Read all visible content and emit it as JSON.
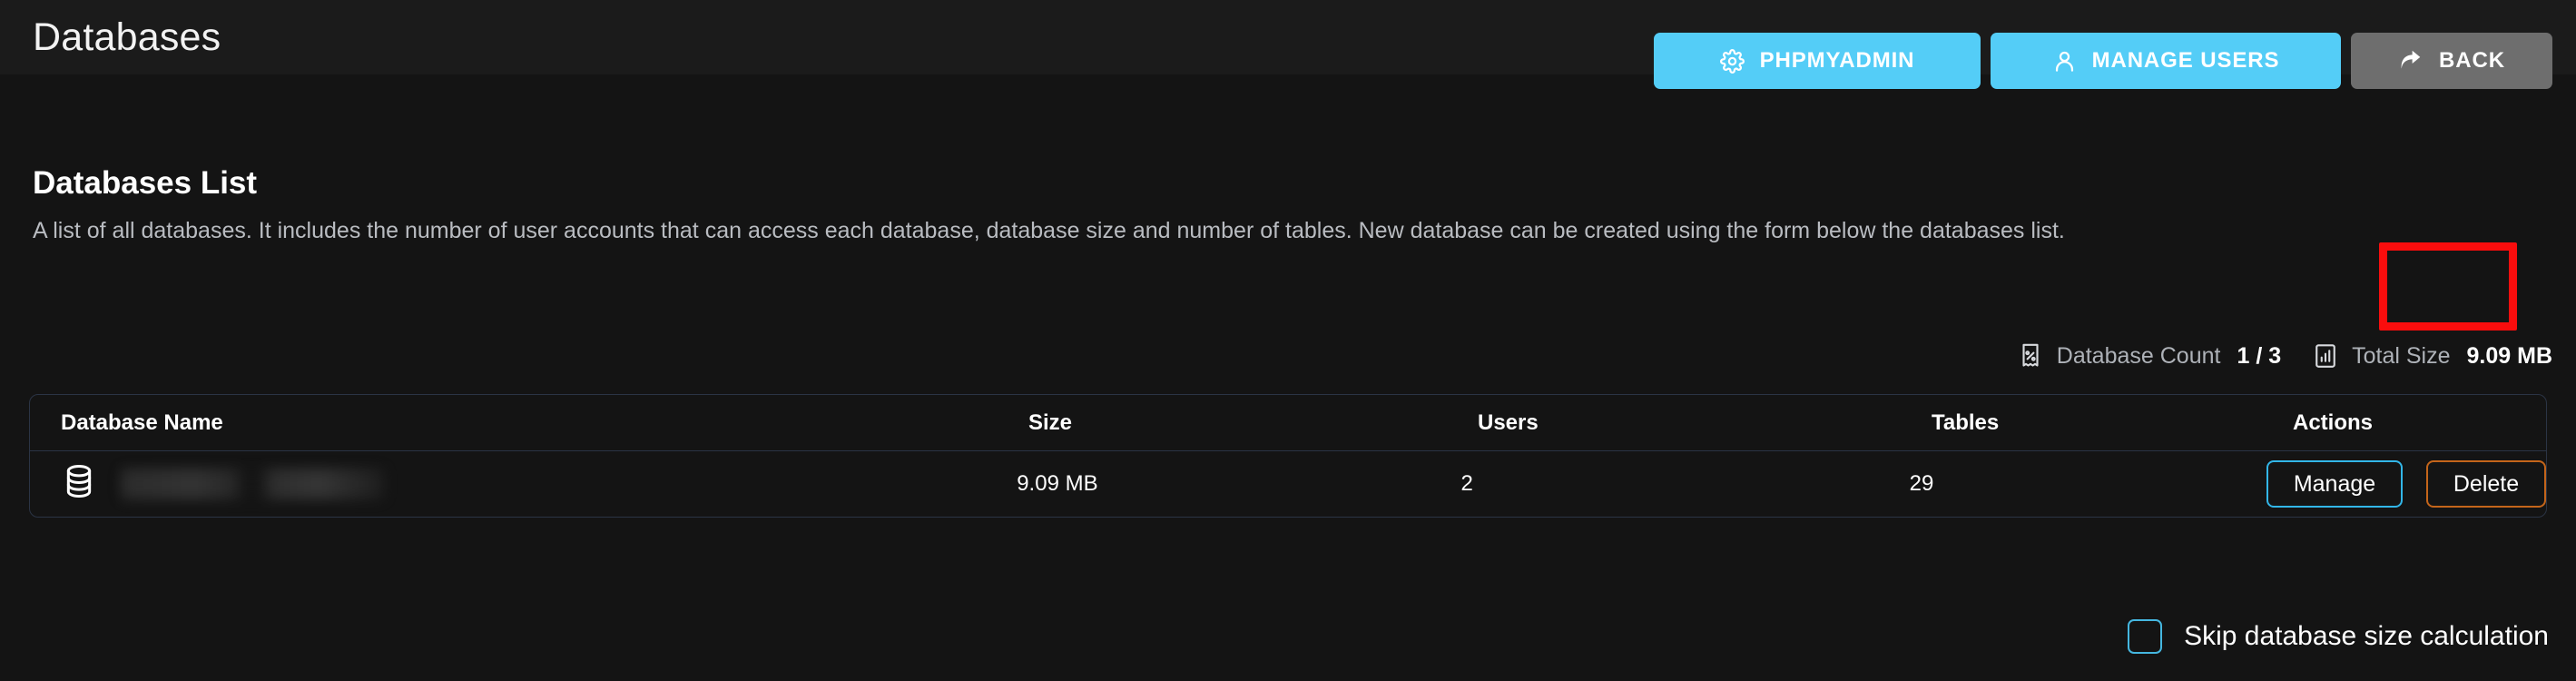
{
  "header": {
    "title": "Databases",
    "buttons": [
      {
        "label": "PHPMYADMIN",
        "icon": "gear-icon",
        "color": "#54cdf7"
      },
      {
        "label": "MANAGE USERS",
        "icon": "user-icon",
        "color": "#54cdf7"
      },
      {
        "label": "BACK",
        "icon": "forward-arrow-icon",
        "color": "#6e6e6e"
      }
    ]
  },
  "main": {
    "section_title": "Databases List",
    "section_description": "A list of all databases. It includes the number of user accounts that can access each database, database size and number of tables. New database can be created using the form below the databases list.",
    "stats": [
      {
        "icon": "receipt-percent-icon",
        "label": "Database Count",
        "value": "1 / 3"
      },
      {
        "icon": "bar-chart-icon",
        "label": "Total Size",
        "value": "9.09 MB"
      }
    ],
    "table": {
      "columns": [
        "Database Name",
        "Size",
        "Users",
        "Tables",
        "Actions"
      ],
      "rows": [
        {
          "icon": "database-stack-icon",
          "name": "",
          "name_redacted": true,
          "size": "9.09 MB",
          "users": "2",
          "tables": "29",
          "actions": [
            {
              "label": "Manage",
              "accent": "#32b6e8"
            },
            {
              "label": "Delete",
              "accent": "#c4651a",
              "highlighted": true
            }
          ]
        }
      ]
    },
    "skip_option": {
      "label": "Skip database size calculation",
      "checked": false
    }
  },
  "annotation": {
    "color": "#fa0d0d",
    "target": "Delete"
  }
}
